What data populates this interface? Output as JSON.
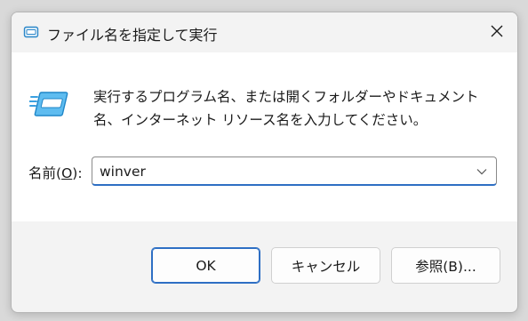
{
  "window": {
    "title": "ファイル名を指定して実行"
  },
  "content": {
    "description": "実行するプログラム名、または開くフォルダーやドキュメント名、インターネット リソース名を入力してください。",
    "name_label_prefix": "名前(",
    "name_label_access_key": "O",
    "name_label_suffix": "):",
    "input_value": "winver"
  },
  "buttons": {
    "ok": "OK",
    "cancel": "キャンセル",
    "browse": "参照(B)..."
  },
  "icons": {
    "title_icon": "run-icon",
    "close_icon": "close-icon",
    "dropdown_icon": "chevron-down-icon",
    "run_icon": "run-icon"
  },
  "colors": {
    "accent": "#2e6fc4",
    "window_bg": "#f3f3f3",
    "content_bg": "#ffffff"
  }
}
